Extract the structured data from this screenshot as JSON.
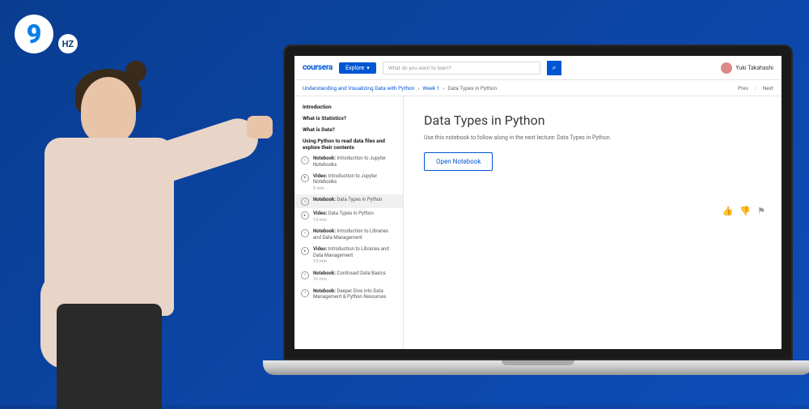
{
  "brand_logo": {
    "main": "9",
    "sub": "HZ"
  },
  "header": {
    "logo": "coursera",
    "explore": "Explore",
    "search_placeholder": "What do you want to learn?",
    "user_name": "Yuki Takahashi"
  },
  "breadcrumb": {
    "course": "Understanding and Visualizing Data with Python",
    "week": "Week 1",
    "current": "Data Types in Python",
    "prev": "Prev",
    "next": "Next"
  },
  "sidebar": {
    "sections": {
      "s0": "Introduction",
      "s1": "What is Statistics?",
      "s2": "What is Data?",
      "s3": "Using Python to read data files and explore their contents"
    },
    "items": [
      {
        "type": "Notebook",
        "title": "Introduction to Jupyter Notebooks",
        "dur": "",
        "icon": "○"
      },
      {
        "type": "Video",
        "title": "Introduction to Jupyter Notebooks",
        "dur": "5 min",
        "icon": "▸"
      },
      {
        "type": "Notebook",
        "title": "Data Types in Python",
        "dur": "",
        "icon": "○",
        "active": true
      },
      {
        "type": "Video",
        "title": "Data Types in Python",
        "dur": "12 min",
        "icon": "▸"
      },
      {
        "type": "Notebook",
        "title": "Introduction to Libraries and Data Management",
        "dur": "",
        "icon": "○"
      },
      {
        "type": "Video",
        "title": "Introduction to Libraries and Data Management",
        "dur": "13 min",
        "icon": "▸"
      },
      {
        "type": "Notebook",
        "title": "Continued Data Basics",
        "dur": "1h min",
        "icon": "○"
      },
      {
        "type": "Notebook",
        "title": "Deeper Dive into Data Management & Python Resources",
        "dur": "",
        "icon": "○"
      }
    ]
  },
  "main": {
    "title": "Data Types in Python",
    "description": "Use this notebook to follow along in the next lecture: Data Types in Python.",
    "button": "Open Notebook"
  }
}
